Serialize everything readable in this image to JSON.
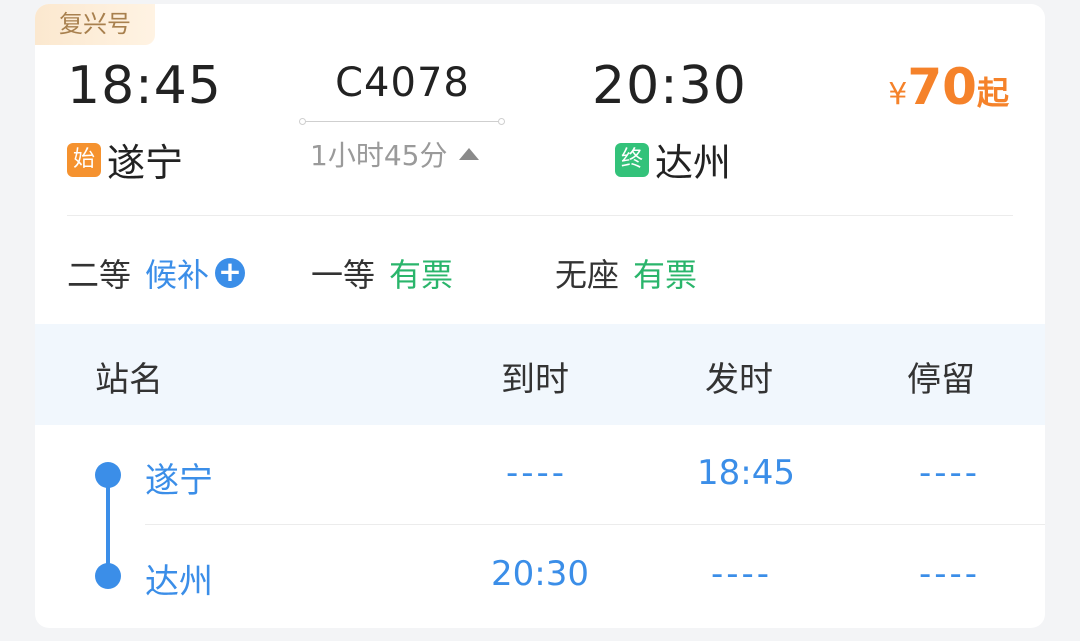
{
  "train": {
    "type_badge": "复兴号",
    "departure_time": "18:45",
    "departure_tag": "始",
    "departure_station": "遂宁",
    "train_number": "C4078",
    "duration": "1小时45分",
    "arrival_time": "20:30",
    "arrival_tag": "终",
    "arrival_station": "达州",
    "price_symbol": "¥",
    "price_amount": "70",
    "price_suffix": "起"
  },
  "seats": [
    {
      "class": "二等",
      "status": "候补"
    },
    {
      "class": "一等",
      "status": "有票"
    },
    {
      "class": "无座",
      "status": "有票"
    }
  ],
  "stops_table": {
    "headers": [
      "站名",
      "到时",
      "发时",
      "停留"
    ],
    "rows": [
      {
        "station": "遂宁",
        "arrive": "----",
        "depart": "18:45",
        "stay": "----"
      },
      {
        "station": "达州",
        "arrive": "20:30",
        "depart": "----",
        "stay": "----"
      }
    ]
  },
  "colors": {
    "accent_blue": "#3b8ee8",
    "accent_green": "#2ab56b",
    "price_orange": "#f5822a",
    "start_tag": "#f5922f",
    "end_tag": "#33c27a"
  }
}
